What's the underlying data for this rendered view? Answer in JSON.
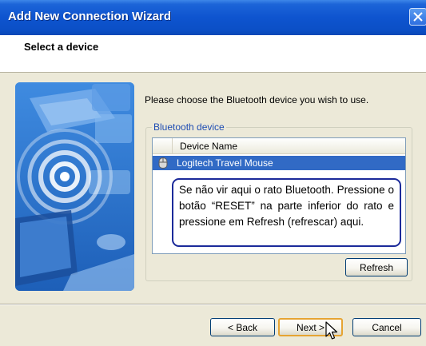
{
  "window": {
    "title": "Add New Connection Wizard",
    "close_icon": "close-icon"
  },
  "header": {
    "title": "Select a device"
  },
  "main": {
    "intro": "Please choose the Bluetooth device you wish to use.",
    "group_label": "Bluetooth device",
    "list": {
      "columns": [
        "",
        "Device Name"
      ],
      "rows": [
        {
          "icon": "mouse-icon",
          "name": "Logitech Travel Mouse",
          "selected": true
        }
      ]
    },
    "callout": "Se não vir aqui o rato Bluetooth. Pressione o botão “RESET” na parte inferior do rato e pressione em Refresh (refrescar) aqui.",
    "refresh_label": "Refresh"
  },
  "footer": {
    "back_label": "< Back",
    "next_label": "Next >",
    "cancel_label": "Cancel"
  },
  "colors": {
    "titlebar": "#0b4fc6",
    "selection": "#316ac5",
    "group_label": "#1f4db3",
    "callout_border": "#1b2a9a"
  }
}
